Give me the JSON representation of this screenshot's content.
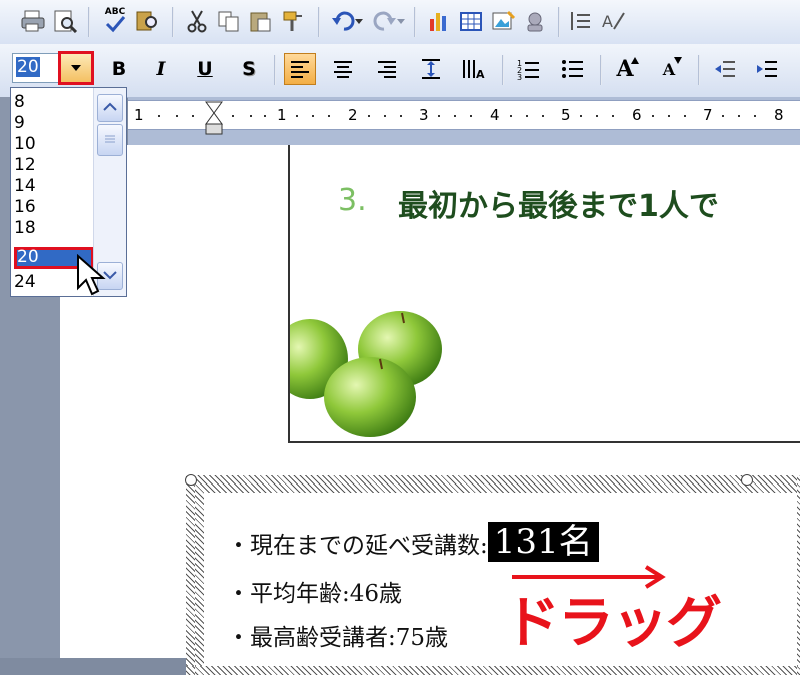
{
  "toolbar": {
    "bold_label": "B",
    "italic_label": "I",
    "underline_label": "U",
    "shadow_label": "S",
    "spell_label": "ABC",
    "grow_font_label": "A",
    "shrink_font_label": "A"
  },
  "font_size": {
    "current_value": "20",
    "options": [
      "8",
      "9",
      "10",
      "12",
      "14",
      "16",
      "18",
      "20",
      "24"
    ]
  },
  "ruler": {
    "numbers": [
      "1",
      "1",
      "2",
      "3",
      "4",
      "5",
      "6",
      "7",
      "8"
    ]
  },
  "slide": {
    "number": "3.",
    "title": "最初から最後まで1人で"
  },
  "textbox": {
    "line1": "・現在までの延べ受講数:",
    "line1_highlight": "131名",
    "line2": "・平均年齢:46歳",
    "line3": "・最高齢受講者:75歳"
  },
  "annotation": {
    "drag_label": "ドラッグ",
    "arrow_color": "#e8131b"
  },
  "colors": {
    "selection": "#316ac5",
    "highlight_border": "#e01020",
    "title_green": "#1e4d1e",
    "number_green": "#7cbf63"
  }
}
